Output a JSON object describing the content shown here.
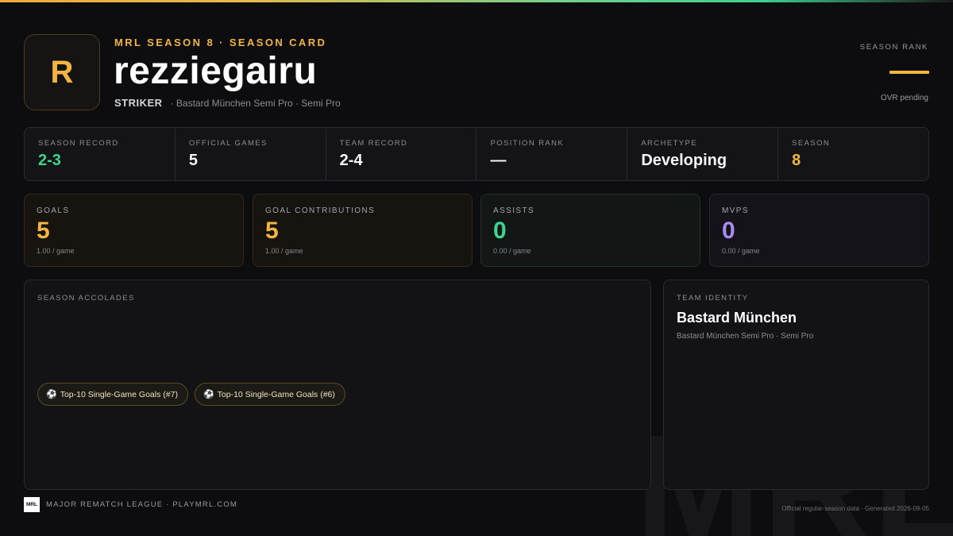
{
  "header": {
    "avatar_initial": "R",
    "eyebrow": "MRL SEASON 8 · SEASON CARD",
    "player_name": "rezziegairu",
    "position": "STRIKER",
    "team_line": "· Bastard München Semi Pro · Semi Pro"
  },
  "rank": {
    "label": "SEASON RANK",
    "note": "OVR pending",
    "accent_color": "#f2b544"
  },
  "summary": [
    {
      "label": "SEASON RECORD",
      "value": "2-3"
    },
    {
      "label": "OFFICIAL GAMES",
      "value": "5"
    },
    {
      "label": "TEAM RECORD",
      "value": "2-4"
    },
    {
      "label": "POSITION RANK",
      "value": "—"
    },
    {
      "label": "ARCHETYPE",
      "value": "Developing"
    },
    {
      "label": "SEASON",
      "value": "8"
    }
  ],
  "stats": [
    {
      "label": "GOALS",
      "value": "5",
      "rate": "1.00 / game",
      "color": "#f2b544"
    },
    {
      "label": "GOAL CONTRIBUTIONS",
      "value": "5",
      "rate": "1.00 / game",
      "color": "#f2b544"
    },
    {
      "label": "ASSISTS",
      "value": "0",
      "rate": "0.00 / game",
      "color": "#3fd390"
    },
    {
      "label": "MVPS",
      "value": "0",
      "rate": "0.00 / game",
      "color": "#a98cf0"
    }
  ],
  "accolades": {
    "label": "SEASON ACCOLADES",
    "icon": "soccer-ball-icon",
    "items": [
      "Top-10 Single-Game Goals (#7)",
      "Top-10 Single-Game Goals (#6)"
    ]
  },
  "team_identity": {
    "label": "TEAM IDENTITY",
    "name": "Bastard München",
    "sub": "Bastard München Semi Pro · Semi Pro"
  },
  "footer": {
    "logo_text": "MRL",
    "league": "MAJOR REMATCH LEAGUE · PLAYMRL.COM",
    "generated": "Official regular-season data · Generated 2026-09-05",
    "watermark": "MRL"
  }
}
